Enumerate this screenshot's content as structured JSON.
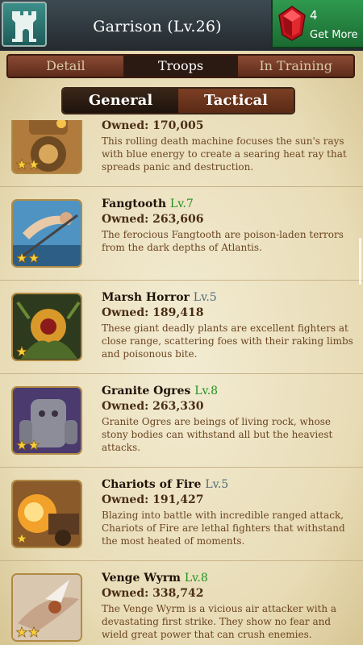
{
  "header": {
    "title": "Garrison (Lv.26)",
    "gems": "4",
    "get_more_label": "Get More"
  },
  "tabs": {
    "top": [
      "Detail",
      "Troops",
      "In Training"
    ],
    "active_top": "Troops",
    "sub": [
      "General",
      "Tactical"
    ],
    "active_sub": "General"
  },
  "colors": {
    "level_green": "#1f8f1f",
    "level_gray": "#4d6a7a"
  },
  "troops": [
    {
      "name": "",
      "level": "",
      "owned": "Owned: 170,005",
      "stars": 2,
      "desc": "This rolling death machine focuses the sun's rays with blue energy to create a searing heat ray that spreads panic and destruction.",
      "art": "war-machine"
    },
    {
      "name": "Fangtooth",
      "level": "Lv.7",
      "level_color": "green",
      "owned": "Owned: 263,606",
      "stars": 2,
      "desc": "The ferocious Fangtooth are poison-laden terrors from the dark depths of Atlantis.",
      "art": "fangtooth"
    },
    {
      "name": "Marsh Horror",
      "level": "Lv.5",
      "level_color": "gray",
      "owned": "Owned: 189,418",
      "stars": 1,
      "desc": "These giant deadly plants are excellent fighters at close range, scattering foes with their raking limbs and poisonous bite.",
      "art": "marsh-horror"
    },
    {
      "name": "Granite Ogres",
      "level": "Lv.8",
      "level_color": "green",
      "owned": "Owned: 263,330",
      "stars": 2,
      "desc": "Granite Ogres are beings of living rock, whose stony bodies can withstand all but the heaviest attacks.",
      "art": "granite-ogre"
    },
    {
      "name": "Chariots of Fire",
      "level": "Lv.5",
      "level_color": "gray",
      "owned": "Owned: 191,427",
      "stars": 1,
      "desc": "Blazing into battle with incredible ranged attack, Chariots of Fire are lethal fighters that withstand the most heated of moments.",
      "art": "chariot-of-fire"
    },
    {
      "name": "Venge Wyrm",
      "level": "Lv.8",
      "level_color": "green",
      "owned": "Owned: 338,742",
      "stars": 2,
      "desc": "The Venge Wyrm is a vicious air attacker with a devastating first strike. They show no fear and wield great power that can crush enemies.",
      "art": "venge-wyrm"
    }
  ]
}
